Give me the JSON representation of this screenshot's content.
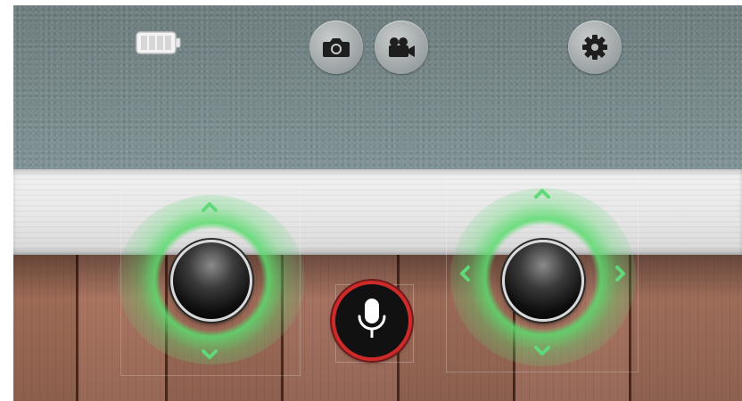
{
  "topbar": {
    "battery_icon": "battery-full-icon",
    "camera_icon": "camera-icon",
    "video_icon": "video-camera-icon",
    "settings_icon": "gear-icon"
  },
  "left_joystick": {
    "up_icon": "chevron-up-icon",
    "down_icon": "chevron-down-icon"
  },
  "right_joystick": {
    "up_icon": "chevron-up-icon",
    "down_icon": "chevron-down-icon",
    "left_icon": "chevron-left-icon",
    "right_icon": "chevron-right-icon"
  },
  "mic": {
    "icon": "microphone-icon"
  },
  "colors": {
    "arrow_green": "#5fd97a",
    "mic_ring": "#cf2a2a",
    "glow": "#5adc6e"
  }
}
